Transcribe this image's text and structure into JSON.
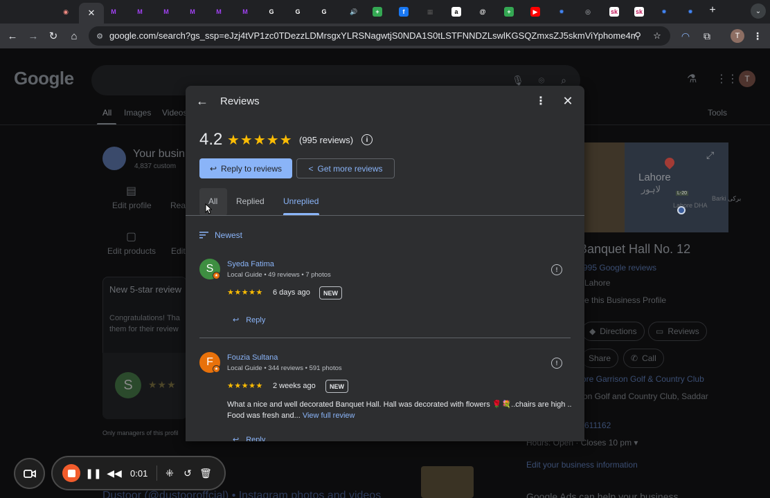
{
  "browser": {
    "tabs": [
      {
        "icon": "record-icon",
        "color": "#f28b82",
        "glyph": "◉"
      },
      {
        "icon": "m-icon",
        "color": "#a142f4",
        "glyph": "M"
      },
      {
        "icon": "m-icon",
        "color": "#a142f4",
        "glyph": "M"
      },
      {
        "icon": "m-icon",
        "color": "#a142f4",
        "glyph": "M"
      },
      {
        "icon": "m-icon",
        "color": "#a142f4",
        "glyph": "M"
      },
      {
        "icon": "m-icon",
        "color": "#a142f4",
        "glyph": "M"
      },
      {
        "icon": "m-icon",
        "color": "#a142f4",
        "glyph": "M"
      },
      {
        "icon": "google-icon",
        "color": "#ffffff",
        "glyph": "G"
      },
      {
        "icon": "google-icon",
        "color": "#ffffff",
        "glyph": "G"
      },
      {
        "icon": "google-icon",
        "color": "#ffffff",
        "glyph": "G"
      },
      {
        "icon": "audio-icon",
        "color": "#202124",
        "glyph": "🔊"
      },
      {
        "icon": "sheets-icon",
        "color": "#34a853",
        "glyph": "+"
      },
      {
        "icon": "facebook-icon",
        "color": "#1877f2",
        "glyph": "f"
      },
      {
        "icon": "grid-icon",
        "color": "#555555",
        "glyph": "▦"
      },
      {
        "icon": "amazon-icon",
        "color": "#ffffff",
        "glyph": "a"
      },
      {
        "icon": "threads-icon",
        "color": "#ffffff",
        "glyph": "@"
      },
      {
        "icon": "sheets-icon",
        "color": "#34a853",
        "glyph": "+"
      },
      {
        "icon": "youtube-icon",
        "color": "#ff0000",
        "glyph": "▶"
      },
      {
        "icon": "gear-blue-icon",
        "color": "#4285f4",
        "glyph": "✹"
      },
      {
        "icon": "chrome-icon",
        "color": "#bdc1c6",
        "glyph": "◎"
      },
      {
        "icon": "sk-icon",
        "color": "#e8eaed",
        "glyph": "sk"
      },
      {
        "icon": "sk-icon",
        "color": "#e8eaed",
        "glyph": "sk"
      },
      {
        "icon": "gear-blue-icon",
        "color": "#4285f4",
        "glyph": "✹"
      },
      {
        "icon": "gear-blue-icon",
        "color": "#4285f4",
        "glyph": "✹"
      }
    ],
    "url": "google.com/search?gs_ssp=eJzj4tVP1zc0TDezzLDMrsgxYLRSNagwtjS0NDA1S0tLSTFNNDZLswlKGSQZmxsZJ5skmViYphome4mklBaX...",
    "profile_initial": "T"
  },
  "google": {
    "logo": "Google",
    "tabs": [
      "All",
      "Images",
      "Videos"
    ],
    "tools": "Tools",
    "avatar_initial": "T",
    "business_title": "Your busin",
    "business_meta": "4,837 custom",
    "actions": [
      "Edit profile",
      "Read",
      "Edit products",
      "Edit"
    ],
    "card_title": "New 5-star review",
    "card_body": [
      "Congratulations! Tha",
      "them for their review"
    ],
    "card_avatar": "S",
    "managers_note": "Only managers of this profil",
    "bottom_link": "Dustoor (@dustooroffcial) • Instagram photos and videos"
  },
  "right_panel": {
    "map_city": "Lahore",
    "map_city_urdu": "لاہور",
    "map_dha": "Lahore DHA",
    "map_barki": "Barki برکی",
    "map_road": "L-20",
    "title": "Banquet Hall No. 12",
    "reviews_link": "995 Google reviews",
    "location": "Lahore",
    "claim": "e this Business Profile",
    "buttons": [
      "Directions",
      "Reviews",
      "Share",
      "Call"
    ],
    "address_link": "ore Garrison Golf & Country Club",
    "address_text": "on Golf and Country Club, Saddar",
    "phone": "611162",
    "hours": "Hours: Open · Closes 10 pm ▾",
    "edit_info": "Edit your business information",
    "ads": "Google Ads can help your business"
  },
  "modal": {
    "title": "Reviews",
    "rating": "4.2",
    "stars": "★★★★★",
    "count": "(995 reviews)",
    "reply_button": "Reply to reviews",
    "more_button": "Get more reviews",
    "tabs": [
      "All",
      "Replied",
      "Unreplied"
    ],
    "sort": "Newest",
    "reviews": [
      {
        "initial": "S",
        "avatar_color": "#34a853",
        "name": "Syeda Fatima",
        "meta": "Local Guide • 49 reviews • 7 photos",
        "stars": "★★★★★",
        "time": "6 days ago",
        "badge": "NEW",
        "text": "",
        "more": "",
        "reply": "Reply"
      },
      {
        "initial": "F",
        "avatar_color": "#e8710a",
        "name": "Fouzia Sultana",
        "meta": "Local Guide • 344 reviews • 591 photos",
        "stars": "★★★★★",
        "time": "2 weeks ago",
        "badge": "NEW",
        "text": "What a nice and well decorated Banquet Hall. Hall was decorated with flowers 🌹💐..chairs are high .. Food was fresh and...",
        "more": "View full review",
        "reply": "Reply"
      }
    ]
  },
  "recorder": {
    "time": "0:01"
  }
}
